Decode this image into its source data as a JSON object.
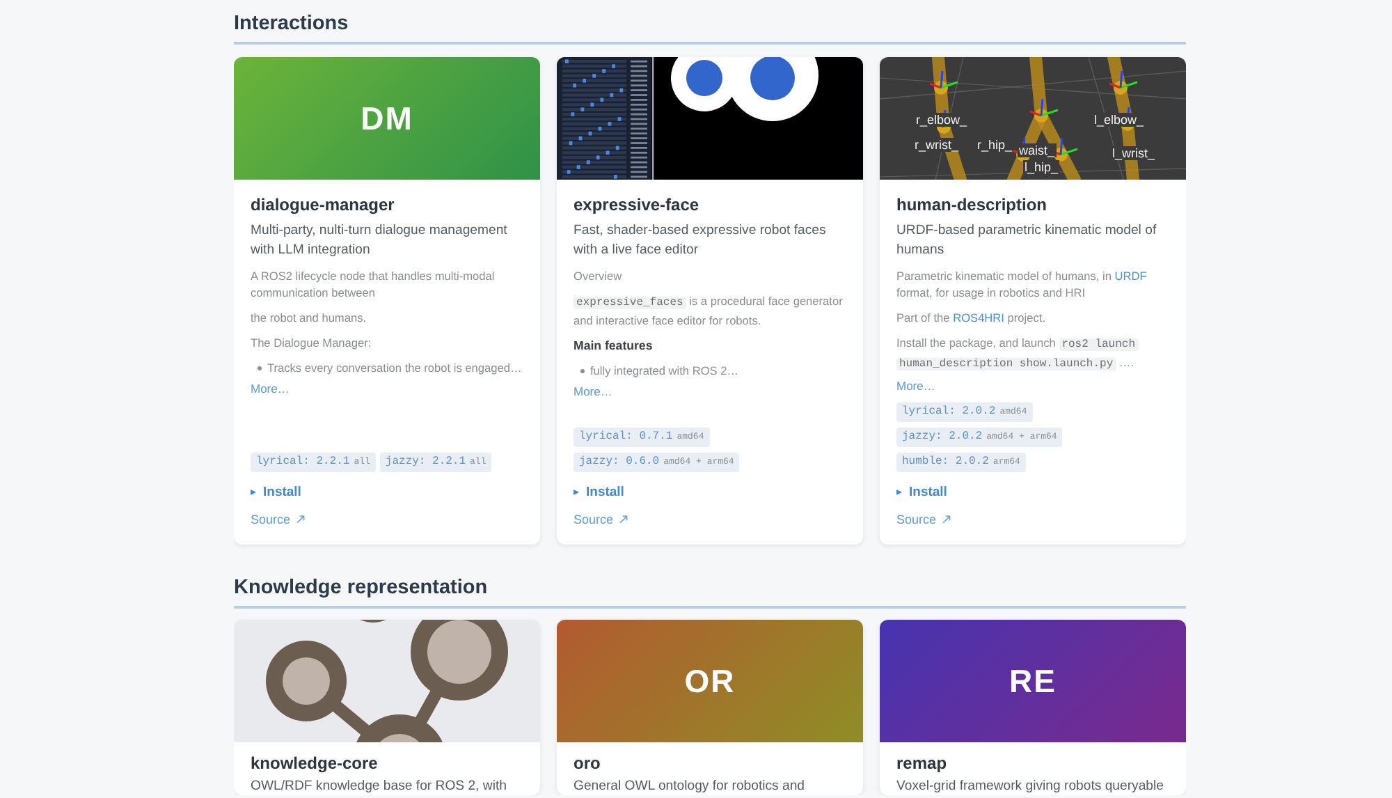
{
  "sections": [
    {
      "title": "Interactions",
      "cards": [
        {
          "name": "dialogue-manager",
          "image": {
            "kind": "initials",
            "text": "DM",
            "color": "#6cb43a"
          },
          "tagline": "Multi-party, nulti-turn dialogue management with LLM integration",
          "blocks": [
            {
              "kind": "text",
              "parts": [
                {
                  "kind": "text",
                  "text": "A ROS2 lifecycle node that handles multi-modal communication between"
                }
              ]
            },
            {
              "kind": "text",
              "parts": [
                {
                  "kind": "text",
                  "text": "the robot and humans."
                }
              ]
            },
            {
              "kind": "text",
              "parts": [
                {
                  "kind": "text",
                  "text": "The Dialogue Manager:"
                }
              ]
            },
            {
              "kind": "bullet",
              "parts": [
                {
                  "kind": "text",
                  "text": "Tracks every conversation the robot is engaged…"
                }
              ]
            }
          ],
          "more": "More…",
          "tags": [
            {
              "release": "lyrical: 2.2.1",
              "arch": "all"
            },
            {
              "release": "jazzy: 2.2.1",
              "arch": "all"
            }
          ],
          "install": {
            "label": "Install",
            "expanded": false
          },
          "source": "Source"
        },
        {
          "name": "expressive-face",
          "image": {
            "kind": "face-editor"
          },
          "tagline": "Fast, shader-based expressive robot faces with a live face editor",
          "blocks": [
            {
              "kind": "text",
              "parts": [
                {
                  "kind": "text",
                  "text": "Overview"
                }
              ]
            },
            {
              "kind": "text",
              "parts": [
                {
                  "kind": "code",
                  "text": "expressive_faces"
                },
                {
                  "kind": "text",
                  "text": " is a procedural face generator and interactive face editor for robots."
                }
              ]
            },
            {
              "kind": "heading",
              "parts": [
                {
                  "kind": "text",
                  "text": "Main features"
                }
              ]
            },
            {
              "kind": "bullet",
              "parts": [
                {
                  "kind": "text",
                  "text": "fully integrated with ROS 2…"
                }
              ]
            }
          ],
          "more": "More…",
          "tags": [
            {
              "release": "lyrical: 0.7.1",
              "arch": "amd64"
            },
            {
              "release": "jazzy: 0.6.0",
              "arch": "amd64 + arm64"
            }
          ],
          "install": {
            "label": "Install",
            "expanded": false
          },
          "source": "Source"
        },
        {
          "name": "human-description",
          "image": {
            "kind": "skeleton",
            "labels": [
              "r_elbow_",
              "l_elbow_",
              "r_wrist_",
              "r_hip_",
              "waist_",
              "l_hip_",
              "l_wrist_"
            ]
          },
          "tagline": "URDF-based parametric kinematic model of humans",
          "blocks": [
            {
              "kind": "text",
              "parts": [
                {
                  "kind": "text",
                  "text": "Parametric kinematic model of humans, in "
                },
                {
                  "kind": "link",
                  "text": "URDF"
                },
                {
                  "kind": "text",
                  "text": " format, for usage in robotics and HRI"
                }
              ]
            },
            {
              "kind": "text",
              "parts": [
                {
                  "kind": "text",
                  "text": "Part of the "
                },
                {
                  "kind": "link",
                  "text": "ROS4HRI"
                },
                {
                  "kind": "text",
                  "text": " project."
                }
              ]
            },
            {
              "kind": "text",
              "parts": [
                {
                  "kind": "text",
                  "text": "Install the package, and launch "
                },
                {
                  "kind": "code",
                  "text": "ros2 launch human_description show.launch.py"
                },
                {
                  "kind": "text",
                  "text": " …."
                }
              ]
            }
          ],
          "more": "More…",
          "tags": [
            {
              "release": "lyrical: 2.0.2",
              "arch": "amd64"
            },
            {
              "release": "jazzy: 2.0.2",
              "arch": "amd64 + arm64"
            },
            {
              "release": "humble: 2.0.2",
              "arch": "arm64"
            }
          ],
          "install": {
            "label": "Install",
            "expanded": false
          },
          "source": "Source"
        }
      ]
    },
    {
      "title": "Knowledge representation",
      "cards": [
        {
          "name": "knowledge-core",
          "image": {
            "kind": "graph-logo"
          },
          "tagline": "OWL/RDF knowledge base for ROS 2, with"
        },
        {
          "name": "oro",
          "image": {
            "kind": "initials",
            "text": "OR",
            "color": "#b35a30"
          },
          "tagline": "General OWL ontology for robotics and"
        },
        {
          "name": "remap",
          "image": {
            "kind": "initials",
            "text": "RE",
            "color": "#4634b0"
          },
          "tagline": "Voxel-grid framework giving robots queryable"
        }
      ]
    }
  ]
}
